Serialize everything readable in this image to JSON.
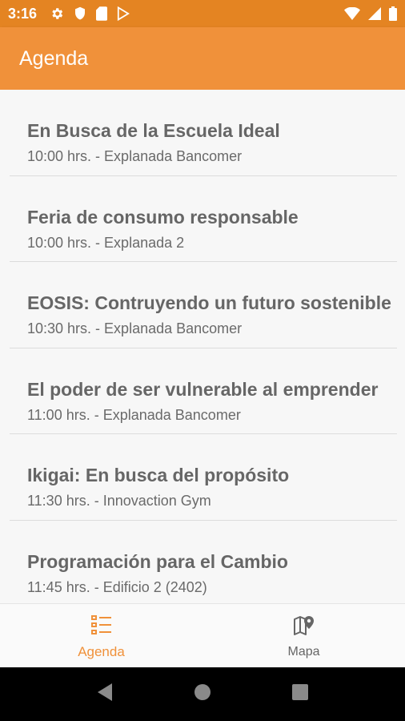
{
  "status_bar": {
    "time": "3:16",
    "left_icons": [
      "gear-icon",
      "shield-icon",
      "sd-card-icon",
      "play-store-icon"
    ],
    "right_icons": [
      "wifi-icon",
      "signal-icon",
      "battery-icon"
    ]
  },
  "app_bar": {
    "title": "Agenda"
  },
  "agenda": {
    "items": [
      {
        "title": "En Busca de la Escuela Ideal",
        "subtitle": "10:00 hrs. - Explanada Bancomer"
      },
      {
        "title": "Feria de consumo responsable",
        "subtitle": "10:00 hrs. - Explanada 2"
      },
      {
        "title": "EOSIS: Contruyendo un futuro sostenible",
        "subtitle": "10:30 hrs. - Explanada Bancomer"
      },
      {
        "title": "El poder de ser vulnerable al emprender",
        "subtitle": "11:00 hrs. - Explanada Bancomer"
      },
      {
        "title": "Ikigai: En busca del propósito",
        "subtitle": "11:30 hrs. - Innovaction Gym"
      },
      {
        "title": "Programación para el Cambio",
        "subtitle": "11:45 hrs. - Edificio 2 (2402)"
      }
    ]
  },
  "bottom_nav": {
    "items": [
      {
        "label": "Agenda",
        "icon": "list-icon",
        "active": true
      },
      {
        "label": "Mapa",
        "icon": "map-pin-icon",
        "active": false
      }
    ]
  },
  "system_nav": {
    "buttons": [
      "back-icon",
      "home-icon",
      "recents-icon"
    ]
  },
  "colors": {
    "status_bar": "#e48422",
    "app_bar": "#f0913a",
    "accent": "#f0913a"
  }
}
